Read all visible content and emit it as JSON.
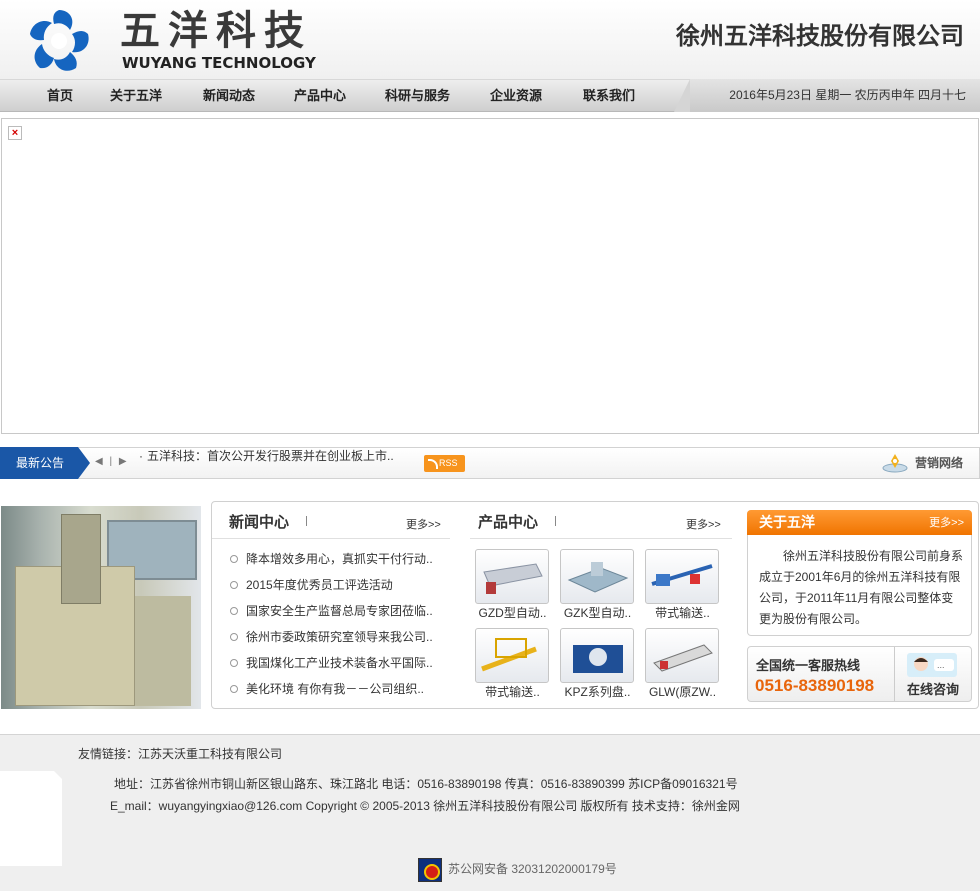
{
  "header": {
    "logo_cn": "五洋科技",
    "logo_en": "WUYANG TECHNOLOGY",
    "company_name": "徐州五洋科技股份有限公司"
  },
  "nav": {
    "items": [
      {
        "label": "首页"
      },
      {
        "label": "关于五洋"
      },
      {
        "label": "新闻动态"
      },
      {
        "label": "产品中心"
      },
      {
        "label": "科研与服务"
      },
      {
        "label": "企业资源"
      },
      {
        "label": "联系我们"
      }
    ],
    "date": "2016年5月23日  星期一  农历丙申年  四月十七"
  },
  "banner": {
    "broken_icon": "broken-image-icon"
  },
  "notice": {
    "label": "最新公告",
    "controls": "◀ | ▶",
    "text": "五洋科技：首次公开发行股票并在创业板上市..",
    "rss": "RSS",
    "marketing": "营销网络"
  },
  "news": {
    "title": "新闻中心",
    "more": "更多>>",
    "items": [
      "降本增效多用心，真抓实干付行动..",
      "2015年度优秀员工评选活动",
      "国家安全生产监督总局专家团莅临..",
      "徐州市委政策研究室领导来我公司..",
      "我国煤化工产业技术装备水平国际..",
      "美化环境 有你有我－－公司组织.."
    ]
  },
  "products": {
    "title": "产品中心",
    "more": "更多>>",
    "items": [
      "GZD型自动..",
      "GZK型自动..",
      "带式输送..",
      "带式输送..",
      "KPZ系列盘..",
      "GLW(原ZW.."
    ]
  },
  "about": {
    "title": "关于五洋",
    "more": "更多>>",
    "text": "徐州五洋科技股份有限公司前身系成立于2001年6月的徐州五洋科技有限公司，于2011年11月有限公司整体变更为股份有限公司。"
  },
  "hotline": {
    "label": "全国统一客服热线",
    "number": "0516-83890198",
    "consult": "在线咨询"
  },
  "footer": {
    "links": "友情链接：江苏天沃重工科技有限公司",
    "address": "地址：江苏省徐州市铜山新区银山路东、珠江路北   电话：0516-83890198   传真：0516-83890399   苏ICP备09016321号",
    "email_copyright": "E_mail：wuyangyingxiao@126.com      Copyright © 2005-2013 徐州五洋科技股份有限公司  版权所有      技术支持：徐州金网",
    "police": "苏公网安备  32031202000179号"
  },
  "colors": {
    "accent_blue": "#1a57a7",
    "accent_orange": "#f07400",
    "hotline_orange": "#e8650c"
  }
}
